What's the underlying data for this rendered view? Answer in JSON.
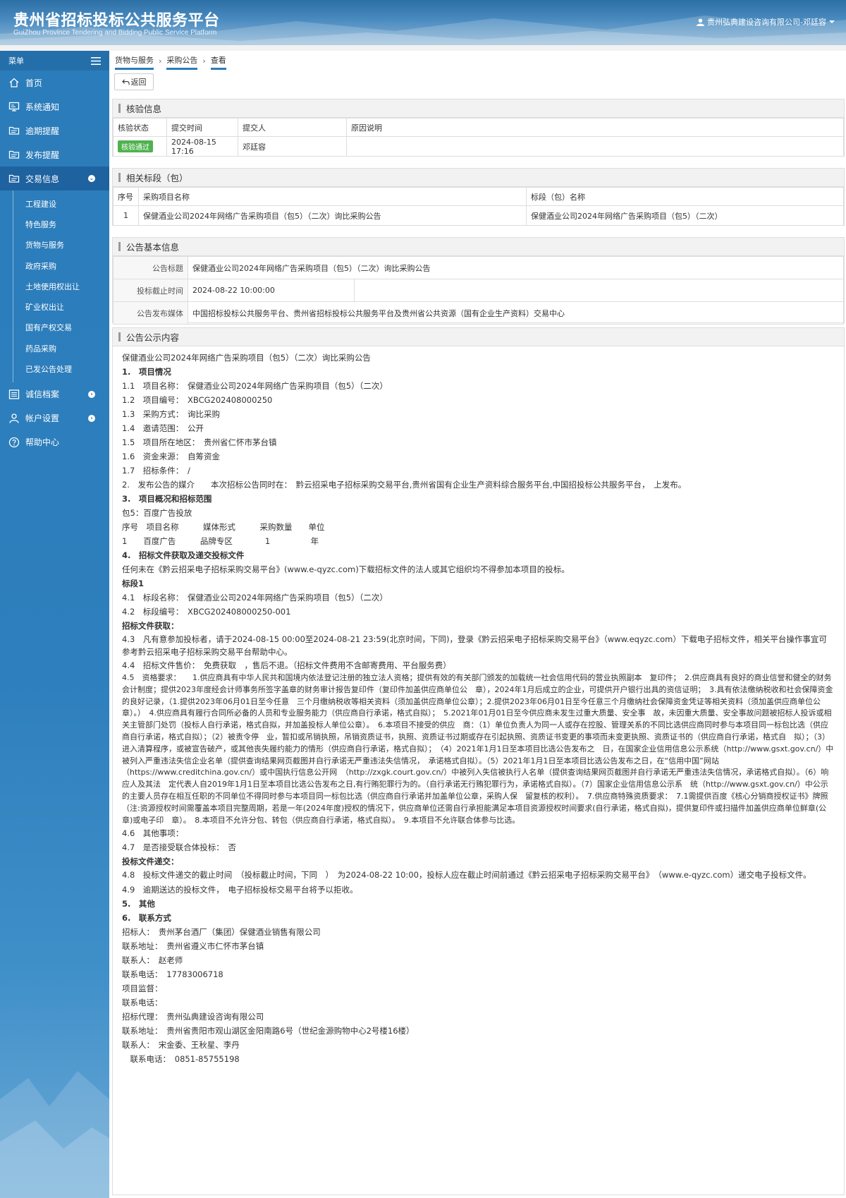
{
  "header": {
    "brand_cn": "贵州省招标投标公共服务平台",
    "brand_en": "GuiZhou Province Tendering and Bidding Public Service Platform",
    "user": "贵州弘典建设咨询有限公司-邓廷容"
  },
  "sidebar": {
    "menu_label": "菜单",
    "items": [
      {
        "label": "首页",
        "icon": "home-icon"
      },
      {
        "label": "系统通知",
        "icon": "monitor-icon"
      },
      {
        "label": "逾期提醒",
        "icon": "folder-icon"
      },
      {
        "label": "发布提醒",
        "icon": "folder-icon"
      },
      {
        "label": "交易信息",
        "icon": "folder-icon"
      }
    ],
    "sub_items": [
      "工程建设",
      "特色服务",
      "货物与服务",
      "政府采购",
      "土地使用权出让",
      "矿业权出让",
      "国有产权交易",
      "药品采购",
      "已发公告处理"
    ],
    "bottom_items": [
      {
        "label": "诚信档案",
        "icon": "list-icon"
      },
      {
        "label": "帐户设置",
        "icon": "user-icon"
      },
      {
        "label": "帮助中心",
        "icon": "help-icon"
      }
    ]
  },
  "breadcrumb": [
    "货物与服务",
    "采购公告",
    "查看"
  ],
  "back_label": "返回",
  "verify": {
    "title": "核验信息",
    "headers": [
      "核验状态",
      "提交时间",
      "提交人",
      "原因说明"
    ],
    "status": "核验通过",
    "time": "2024-08-15 17:16",
    "person": "邓廷容",
    "reason": ""
  },
  "sections": {
    "title": "相关标段（包）",
    "headers": [
      "序号",
      "采购项目名称",
      "标段（包）名称"
    ],
    "rows": [
      {
        "no": "1",
        "project": "保健酒业公司2024年网络广告采购项目（包5）（二次）询比采购公告",
        "section": "保健酒业公司2024年网络广告采购项目（包5）（二次）"
      }
    ]
  },
  "basic": {
    "title": "公告基本信息",
    "title_label": "公告标题",
    "title_value": "保健酒业公司2024年网络广告采购项目（包5）（二次）询比采购公告",
    "deadline_label": "投标截止时间",
    "deadline_value": "2024-08-22 10:00:00",
    "media_label": "公告发布媒体",
    "media_value": "中国招标投标公共服务平台、贵州省招标投标公共服务平台及贵州省公共资源（国有企业生产资料）交易中心"
  },
  "notice": {
    "title": "公告公示内容",
    "lines": [
      "保健酒业公司2024年网络广告采购项目（包5）（二次）询比采购公告",
      "1.　项目情况",
      "1.1　项目名称：　保健酒业公司2024年网络广告采购项目（包5）（二次）",
      "1.2　项目编号：　XBCG202408000250",
      "1.3　采购方式：　询比采购",
      "1.4　邀请范围：　公开",
      "1.5　项目所在地区：　贵州省仁怀市茅台镇",
      "1.6　资金来源：　自筹资金",
      "1.7　招标条件：　/",
      "2.　发布公告的媒介　　本次招标公告同时在：　黔云招采电子招标采购交易平台,贵州省国有企业生产资料综合服务平台,中国招投标公共服务平台，　上发布。",
      "3.　项目概况和招标范围",
      "包5：百度广告投放",
      "序号　项目名称　　　媒体形式　　　采购数量　　单位",
      "1　　百度广告　　　品牌专区　　　　1　　　　　年",
      "4.　招标文件获取及递交投标文件",
      "任何未在《黔云招采电子招标采购交易平台》(www.e-qyzc.com)下载招标文件的法人或其它组织均不得参加本项目的投标。",
      "标段1",
      "4.1　标段名称：　保健酒业公司2024年网络广告采购项目（包5）（二次）",
      "4.2　标段编号：　XBCG202408000250-001",
      "招标文件获取：",
      "4.3　凡有意参加投标者，请于2024-08-15 00:00至2024-08-21 23:59(北京时间，下同)，登录《黔云招采电子招标采购交易平台》（www.eqyzc.com）下载电子招标文件，相关平台操作事宜可参考黔云招采电子招标采购交易平台帮助中心。",
      "4.4　招标文件售价：　免费获取　，售后不退。（招标文件费用不含邮寄费用、平台服务费）",
      "4.5　资格要求：　　1.供应商具有中华人民共和国境内依法登记注册的独立法人资格；提供有效的有关部门颁发的加载统一社会信用代码的营业执照副本　复印件；　2.供应商具有良好的商业信誉和健全的财务会计制度；提供2023年度经会计师事务所签字盖章的财务审计报告复印件（复印件加盖供应商单位公　章），2024年1月后成立的企业，可提供开户银行出具的资信证明；　3.具有依法缴纳税收和社会保障资金的良好记录，（1.提供2023年06月01日至今任意　三个月缴纳税收等相关资料（须加盖供应商单位公章）；2.提供2023年06月01日至今任意三个月缴纳社会保障资金凭证等相关资料（须加盖供应商单位公　章）。）　4.供应商具有履行合同所必备的人员和专业服务能力（供应商自行承诺，格式自拟）；　5.2021年01月01日至今供应商未发生过重大质量、安全事　故，未因重大质量、安全事故问题被招标人投诉或相关主管部门处罚（投标人自行承诺，格式自拟，并加盖投标人单位公章）。　6.本项目不接受的供应　商：（1）单位负责人为同一人或存在控股、管理关系的不同比选供应商同时参与本项目同一标包比选（供应商自行承诺，格式自拟）；（2）被责令停　业，暂扣或吊销执照，吊销资质证书，执照、资质证书过期或存在引起执照、资质证书变更的事项而未变更执照、资质证书的（供应商自行承诺，格式自　拟）；（3）进入清算程序，或被宣告破产，或其他丧失履约能力的情形（供应商自行承诺，格式自拟）；　（4）2021年1月1日至本项目比选公告发布之　日，在国家企业信用信息公示系统（http://www.gsxt.gov.cn/）中被列入严重违法失信企业名单（提供查询结果网页截图并自行承诺无严重违法失信情况，　承诺格式自拟）。（5）2021年1月1日至本项目比选公告发布之日，在“信用中国”网站（https://www.creditchina.gov.cn/）或中国执行信息公开网　（http://zxgk.court.gov.cn/）中被列入失信被执行人名单（提供查询结果网页截图并自行承诺无严重违法失信情况，承诺格式自拟）。（6）响应人及其法　定代表人自2019年1月1日至本项目比选公告发布之日,有行贿犯罪行为的。（自行承诺无行贿犯罪行为，承诺格式自拟）。（7）国家企业信用信息公示系　统（http://www.gsxt.gov.cn/）中公示的主要人员存在相互任职的不同单位不得同时参与本项目同一标包比选（供应商自行承诺并加盖单位公章，采购人保　留复核的权利）。　7.供应商特殊资质要求：　7.1需提供百度《核心分销商授权证书》牌照（注:资源授权时间需覆盖本项目完整周期，若是一年(2024年度)授权的情况下，供应商单位还需自行承担能满足本项目资源授权时间要求(自行承诺，格式自拟)，提供复印件或扫描件加盖供应商单位鲜章(公章)或电子印　章）。　8.本项目不允许分包、转包（供应商自行承诺，格式自拟）。　9.本项目不允许联合体参与比选。",
      "4.6　其他事项：",
      "4.7　是否接受联合体投标：　否",
      "投标文件递交：",
      "4.8　投标文件递交的截止时间　（投标截止时间，下同　）　为2024-08-22 10:00，投标人应在截止时间前通过《黔云招采电子招标采购交易平台》　（www.e-qyzc.com）递交电子投标文件。",
      "4.9　逾期送达的投标文件，　电子招标投标交易平台将予以拒收。",
      "5.　其他",
      "6.　联系方式",
      "招标人：　贵州茅台酒厂（集团）保健酒业销售有限公司",
      "联系地址：　贵州省遵义市仁怀市茅台镇",
      "联系人：　赵老师",
      "联系电话：　17783006718",
      "项目监督：",
      "联系电话：",
      "招标代理：　贵州弘典建设咨询有限公司",
      "联系地址：　贵州省贵阳市观山湖区金阳南路6号（世纪金源购物中心2号楼16楼）",
      "联系人：　宋金委、王秋星、李丹",
      "　联系电话：　0851-85755198"
    ]
  }
}
